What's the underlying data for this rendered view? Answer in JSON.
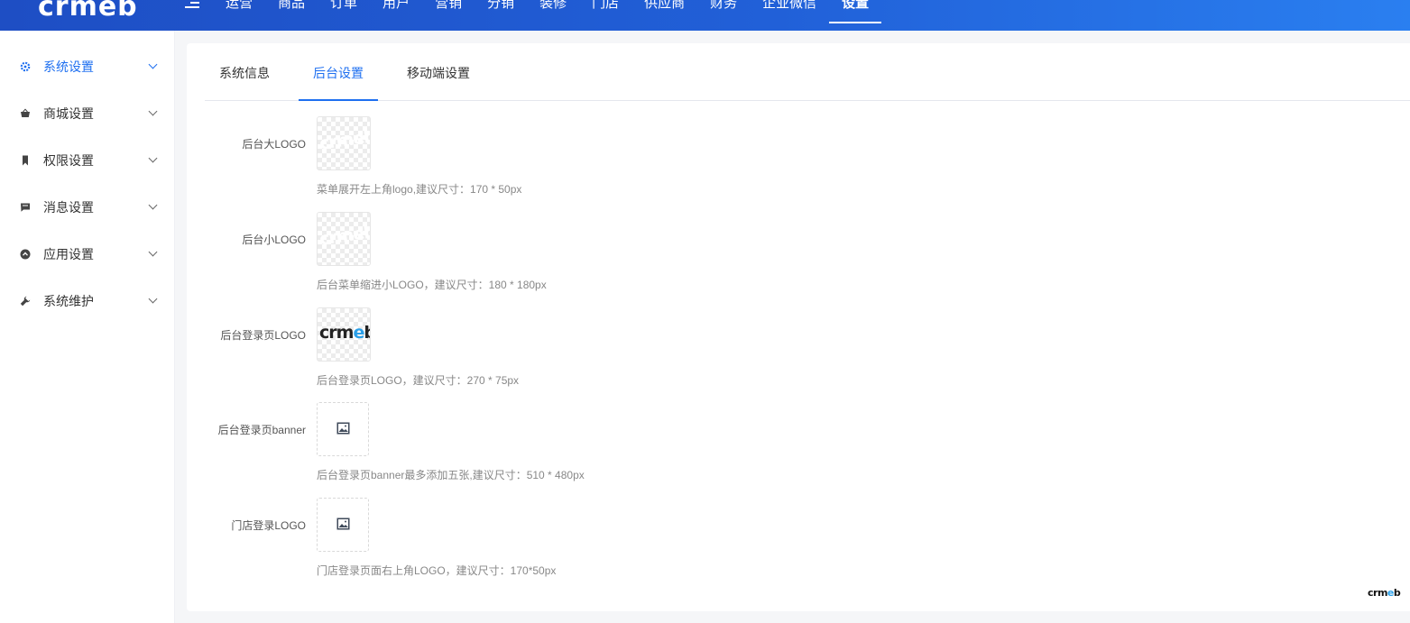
{
  "header": {
    "logo_text": "crmeb",
    "nav": [
      "运营",
      "商品",
      "订单",
      "用户",
      "营销",
      "分销",
      "装修",
      "门店",
      "供应商",
      "财务",
      "企业微信",
      "设置"
    ],
    "active_nav": "设置"
  },
  "sidebar": {
    "items": [
      {
        "label": "系统设置",
        "icon": "gear-icon",
        "active": true
      },
      {
        "label": "商城设置",
        "icon": "basket-icon",
        "active": false
      },
      {
        "label": "权限设置",
        "icon": "bookmark-icon",
        "active": false
      },
      {
        "label": "消息设置",
        "icon": "message-icon",
        "active": false
      },
      {
        "label": "应用设置",
        "icon": "app-icon",
        "active": false
      },
      {
        "label": "系统维护",
        "icon": "wrench-icon",
        "active": false
      }
    ]
  },
  "tabs": [
    "系统信息",
    "后台设置",
    "移动端设置"
  ],
  "active_tab": "后台设置",
  "form": {
    "fields": [
      {
        "label": "后台大LOGO",
        "hint": "菜单展开左上角logo,建议尺寸：170 * 50px",
        "type": "image"
      },
      {
        "label": "后台小LOGO",
        "hint": "后台菜单缩进小LOGO，建议尺寸：180 * 180px",
        "type": "image"
      },
      {
        "label": "后台登录页LOGO",
        "hint": "后台登录页LOGO，建议尺寸：270 * 75px",
        "type": "image"
      },
      {
        "label": "后台登录页banner",
        "hint": "后台登录页banner最多添加五张,建议尺寸：510 * 480px",
        "type": "upload"
      },
      {
        "label": "门店登录LOGO",
        "hint": "门店登录页面右上角LOGO，建议尺寸：170*50px",
        "type": "upload"
      }
    ]
  },
  "watermark_text": "crmeb",
  "colors": {
    "primary": "#1e6ff0",
    "header_start": "#1e4ec4",
    "header_end": "#2a7ff0"
  }
}
